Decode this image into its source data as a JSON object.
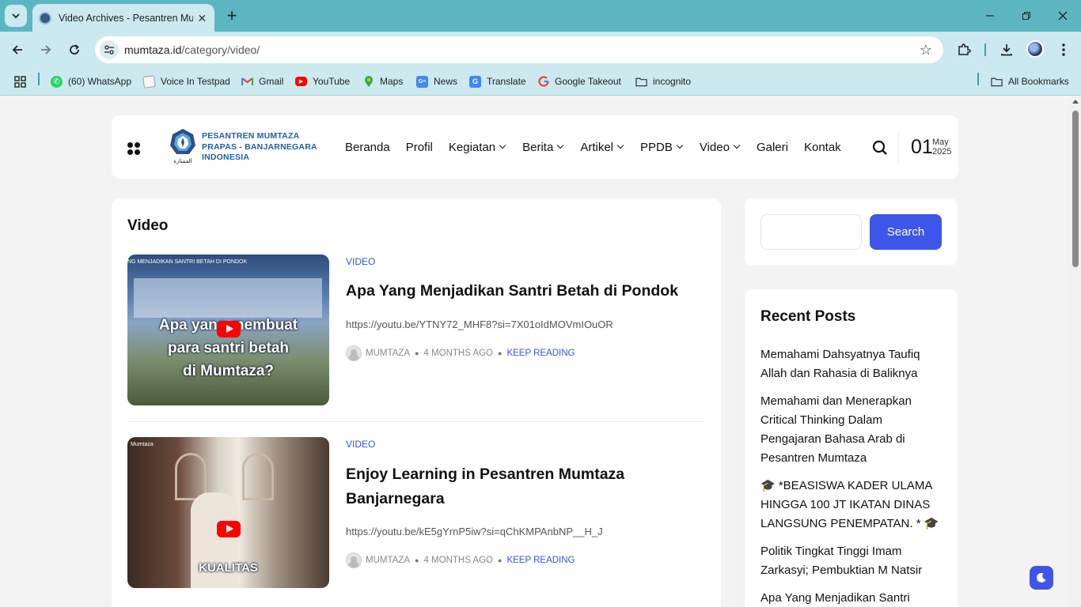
{
  "browser": {
    "tab_title": "Video Archives - Pesantren Mumtaza",
    "url_domain": "mumtaza.id",
    "url_path": "/category/video/",
    "bookmarks": [
      {
        "label": "(60) WhatsApp",
        "icon": "whatsapp-icon",
        "color": "#25d366"
      },
      {
        "label": "Voice In Testpad",
        "icon": "notepad-icon",
        "color": "#f2f2f2"
      },
      {
        "label": "Gmail",
        "icon": "gmail-icon",
        "color": "#ea4335"
      },
      {
        "label": "YouTube",
        "icon": "youtube-icon",
        "color": "#ff0000"
      },
      {
        "label": "Maps",
        "icon": "maps-icon",
        "color": "#34a853"
      },
      {
        "label": "News",
        "icon": "news-icon",
        "color": "#4285f4"
      },
      {
        "label": "Translate",
        "icon": "translate-icon",
        "color": "#4285f4"
      },
      {
        "label": "Google Takeout",
        "icon": "google-icon",
        "color": "#ffffff"
      },
      {
        "label": "incognito",
        "icon": "folder-icon",
        "color": "#cbe9ee"
      }
    ],
    "all_bookmarks": "All Bookmarks"
  },
  "site": {
    "logo_lines": [
      "PESANTREN MUMTAZA",
      "PRAPAS - BANJARNEGARA",
      "INDONESIA"
    ],
    "logo_arabic": "الممتازة",
    "nav": [
      {
        "label": "Beranda",
        "dropdown": false
      },
      {
        "label": "Profil",
        "dropdown": false
      },
      {
        "label": "Kegiatan",
        "dropdown": true
      },
      {
        "label": "Berita",
        "dropdown": true
      },
      {
        "label": "Artikel",
        "dropdown": true
      },
      {
        "label": "PPDB",
        "dropdown": true
      },
      {
        "label": "Video",
        "dropdown": true
      },
      {
        "label": "Galeri",
        "dropdown": false
      },
      {
        "label": "Kontak",
        "dropdown": false
      }
    ],
    "date_day": "01",
    "date_month": "May",
    "date_year": "2025",
    "accent_color": "#3d55e8"
  },
  "content": {
    "heading": "Video",
    "posts": [
      {
        "category": "VIDEO",
        "title": "Apa Yang Menjadikan Santri Betah di Pondok",
        "excerpt": "https://youtu.be/YTNY72_MHF8?si=7X01oIdMOVmIOuOR",
        "author": "MUMTAZA",
        "time": "4 MONTHS AGO",
        "read_more": "KEEP READING",
        "thumb_top": "NG MENJADIKAN SANTRI BETAH DI PONDOK",
        "thumb_caption": [
          "Apa yang membuat",
          "para santri betah",
          "di Mumtaza?"
        ]
      },
      {
        "category": "VIDEO",
        "title": "Enjoy Learning in Pesantren Mumtaza Banjarnegara",
        "excerpt": "https://youtu.be/kE5gYrnP5iw?si=qChKMPAnbNP__H_J",
        "author": "MUMTAZA",
        "time": "4 MONTHS AGO",
        "read_more": "KEEP READING",
        "thumb_top": "Mumtaza",
        "thumb_caption": [
          "KUALITAS"
        ]
      }
    ]
  },
  "sidebar": {
    "search_button": "Search",
    "recent_title": "Recent Posts",
    "recent_posts": [
      "Memahami Dahsyatnya Taufiq Allah dan Rahasia di Baliknya",
      "Memahami dan Menerapkan Critical Thinking Dalam Pengajaran Bahasa Arab di Pesantren Mumtaza",
      "🎓 *BEASISWA KADER ULAMA HINGGA 100 JT IKATAN DINAS LANGSUNG PENEMPATAN. * 🎓",
      "Politik Tingkat Tinggi Imam Zarkasyi; Pembuktian M Natsir",
      "Apa Yang Menjadikan Santri"
    ]
  }
}
